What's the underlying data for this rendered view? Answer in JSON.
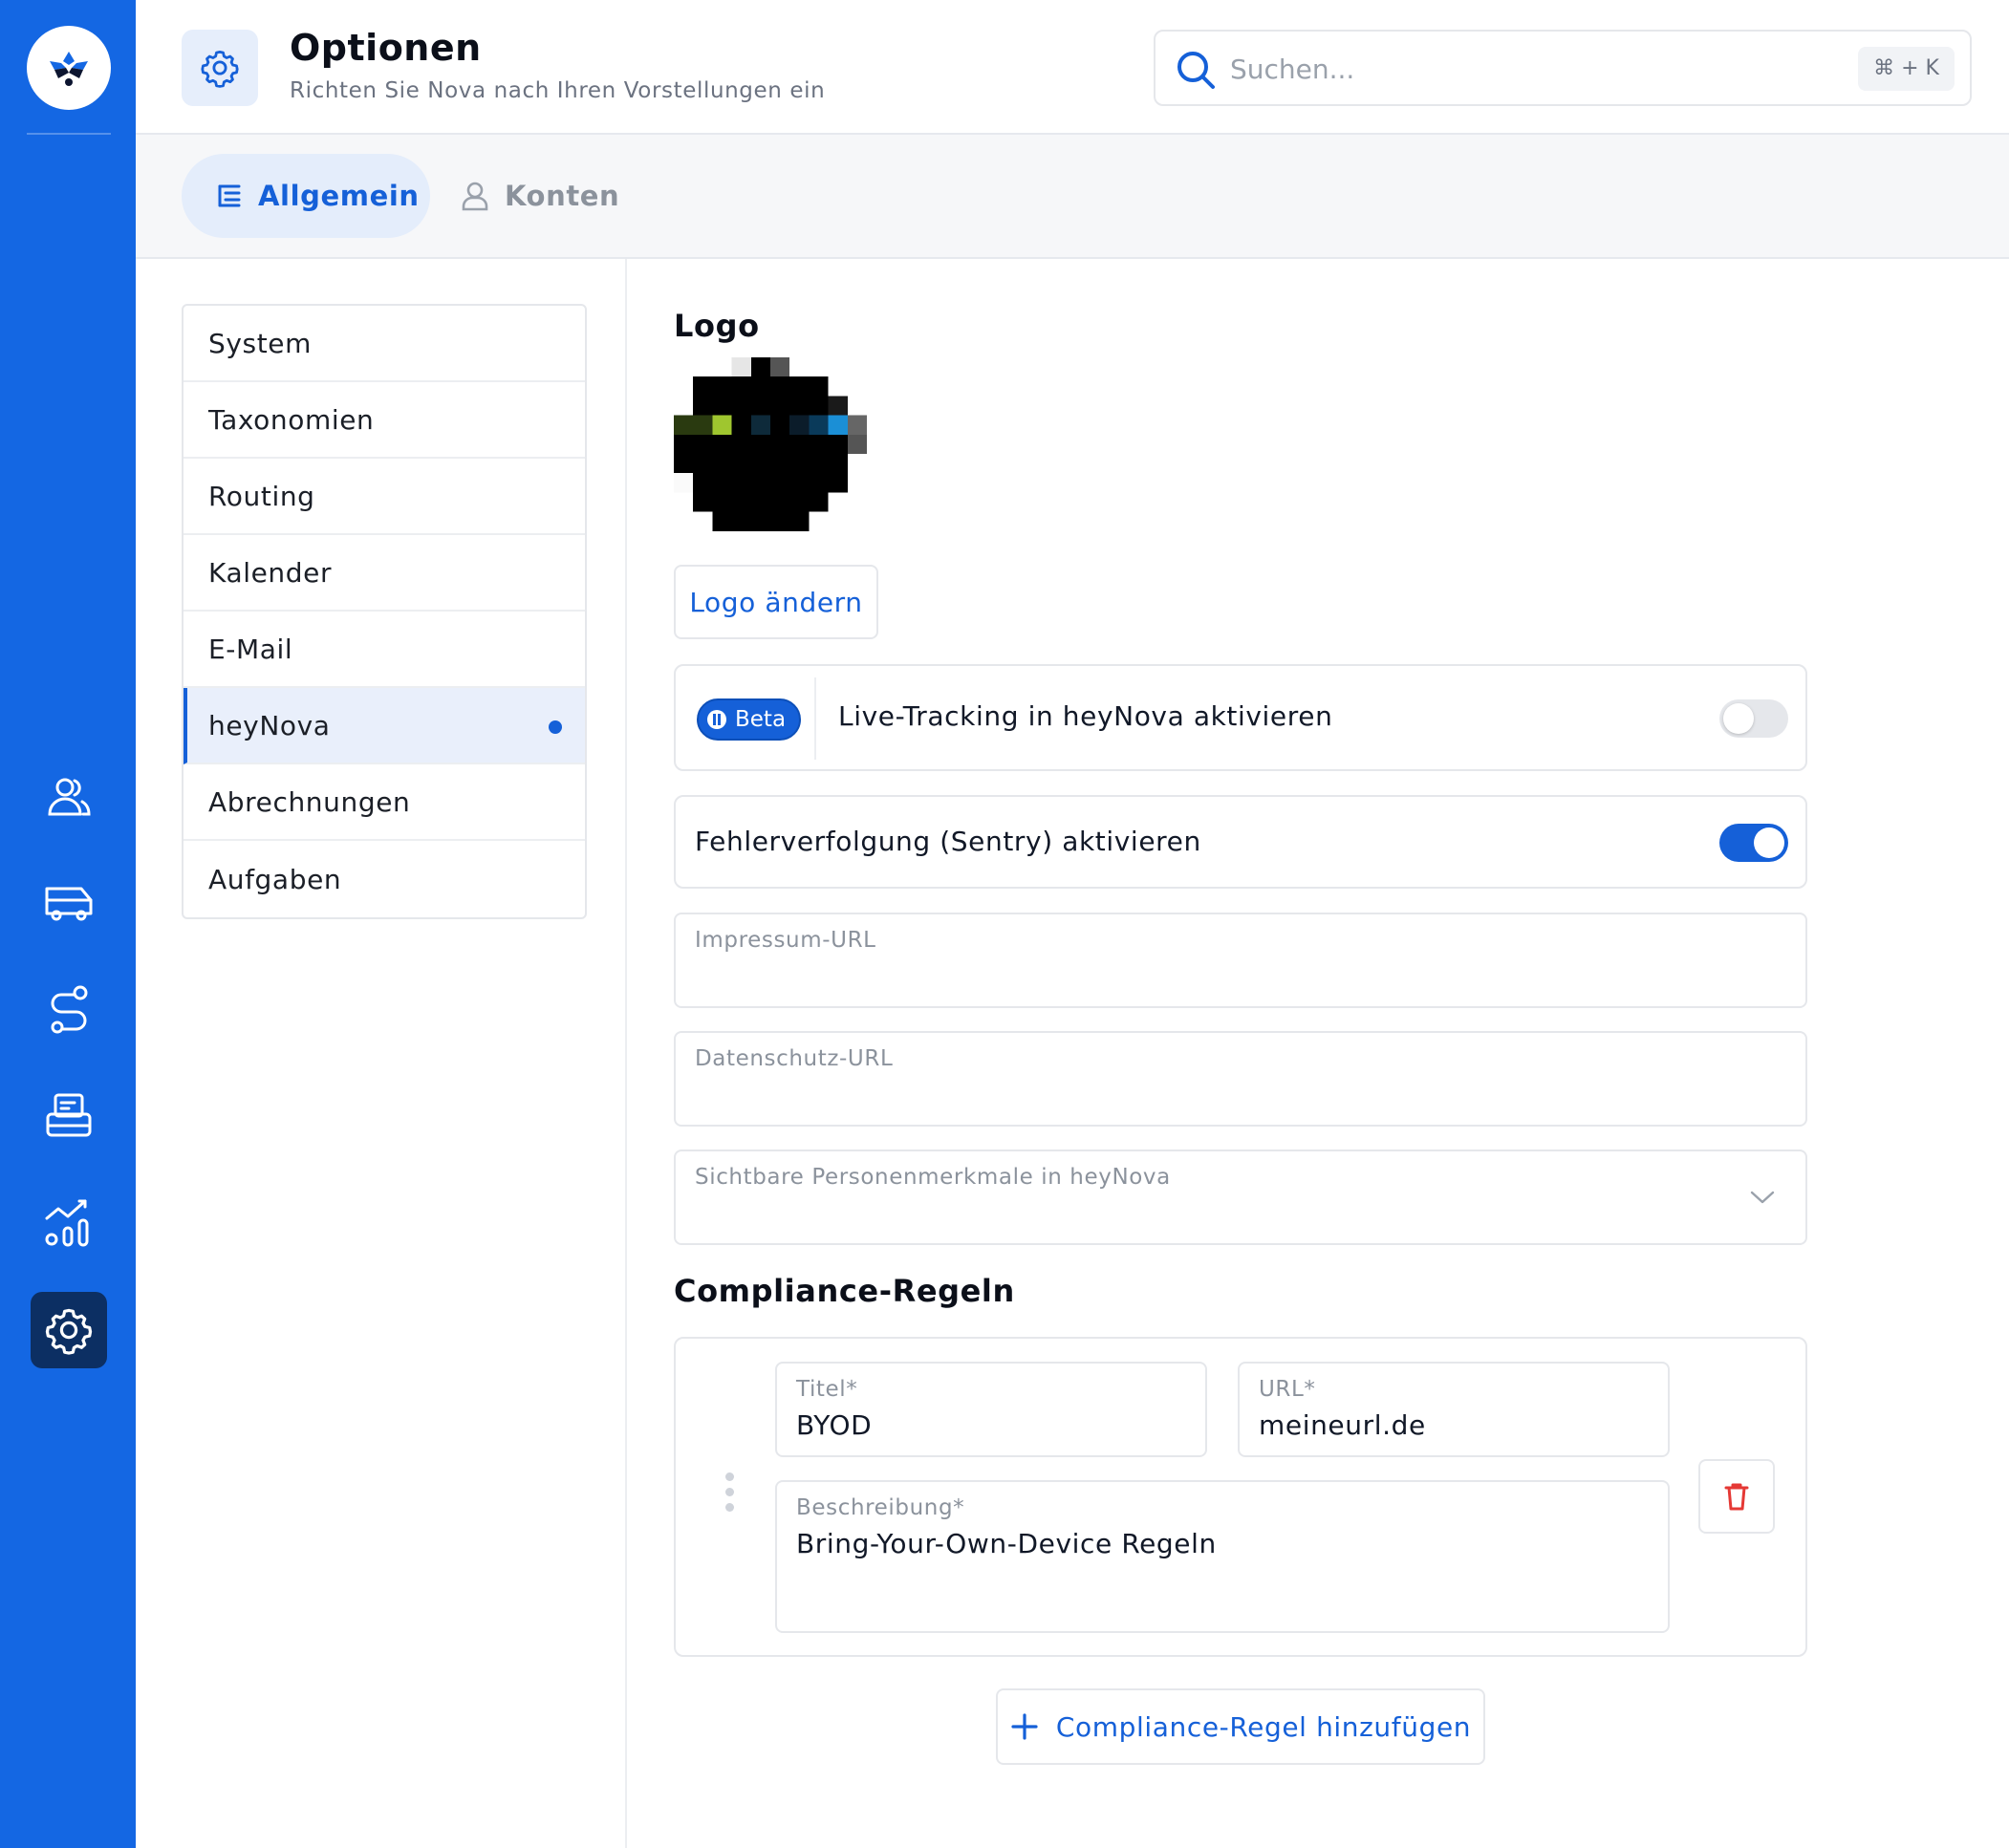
{
  "header": {
    "title": "Optionen",
    "subtitle": "Richten Sie Nova nach Ihren Vorstellungen ein",
    "search_placeholder": "Suchen...",
    "shortcut": "⌘ + K"
  },
  "tabs": [
    {
      "label": "Allgemein",
      "active": true,
      "icon": "list-icon"
    },
    {
      "label": "Konten",
      "active": false,
      "icon": "user-icon"
    }
  ],
  "sidebar_nav": [
    {
      "name": "people-icon"
    },
    {
      "name": "bus-icon"
    },
    {
      "name": "route-icon"
    },
    {
      "name": "printer-icon"
    },
    {
      "name": "analytics-icon"
    },
    {
      "name": "settings-icon",
      "active": true
    }
  ],
  "menu": {
    "items": [
      {
        "label": "System"
      },
      {
        "label": "Taxonomien"
      },
      {
        "label": "Routing"
      },
      {
        "label": "Kalender"
      },
      {
        "label": "E-Mail"
      },
      {
        "label": "heyNova",
        "active": true
      },
      {
        "label": "Abrechnungen"
      },
      {
        "label": "Aufgaben"
      }
    ]
  },
  "content": {
    "logo_heading": "Logo",
    "change_logo": "Logo ändern",
    "beta_badge": "Beta",
    "live_tracking_label": "Live-Tracking in heyNova aktivieren",
    "live_tracking_enabled": false,
    "sentry_label": "Fehlerverfolgung (Sentry) aktivieren",
    "sentry_enabled": true,
    "impressum_label": "Impressum-URL",
    "impressum_value": "",
    "datenschutz_label": "Datenschutz-URL",
    "datenschutz_value": "",
    "attributes_label": "Sichtbare Personenmerkmale in heyNova",
    "attributes_value": "",
    "compliance_heading": "Compliance-Regeln",
    "rules": [
      {
        "title_label": "Titel*",
        "title_value": "BYOD",
        "url_label": "URL*",
        "url_value": "meineurl.de",
        "description_label": "Beschreibung*",
        "description_value": "Bring-Your-Own-Device Regeln"
      }
    ],
    "add_rule": "Compliance-Regel hinzufügen"
  },
  "colors": {
    "rail": "#1467e3",
    "accent": "#1560d8",
    "danger": "#e53935"
  }
}
